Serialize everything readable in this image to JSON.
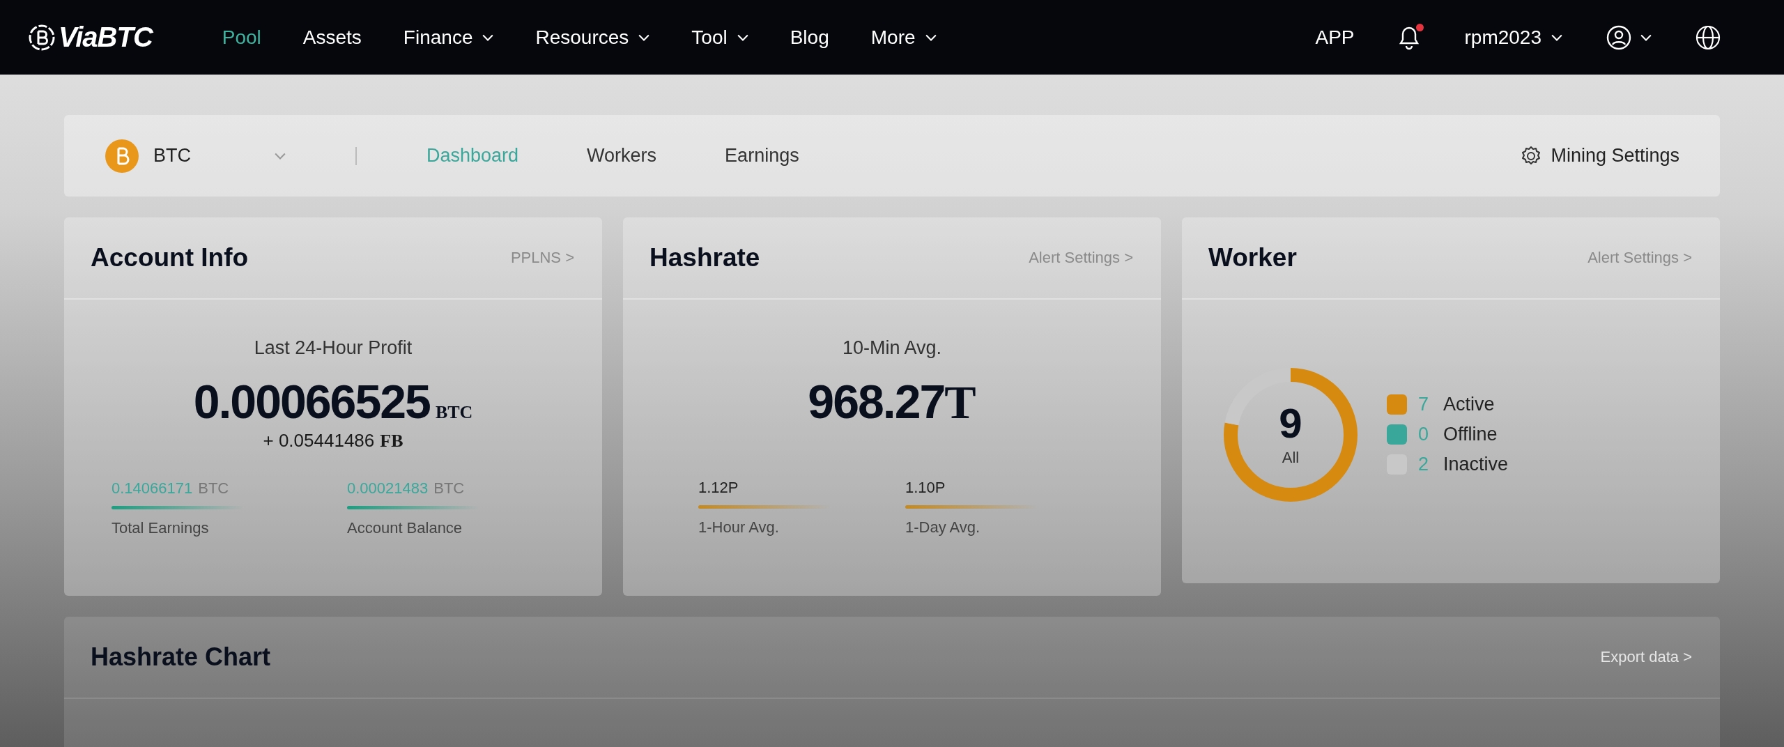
{
  "nav": {
    "logo": "ViaBTC",
    "items": [
      {
        "label": "Pool",
        "selected": true,
        "dropdown": false
      },
      {
        "label": "Assets",
        "selected": false,
        "dropdown": false
      },
      {
        "label": "Finance",
        "selected": false,
        "dropdown": true
      },
      {
        "label": "Resources",
        "selected": false,
        "dropdown": true
      },
      {
        "label": "Tool",
        "selected": false,
        "dropdown": true
      },
      {
        "label": "Blog",
        "selected": false,
        "dropdown": false
      },
      {
        "label": "More",
        "selected": false,
        "dropdown": true
      }
    ],
    "app": "APP",
    "notification_dot": true,
    "username": "rpm2023"
  },
  "subnav": {
    "coin": "BTC",
    "tabs": [
      {
        "label": "Dashboard",
        "selected": true
      },
      {
        "label": "Workers",
        "selected": false
      },
      {
        "label": "Earnings",
        "selected": false
      }
    ],
    "settings": "Mining Settings"
  },
  "account_info": {
    "title": "Account Info",
    "link": "PPLNS >",
    "caption": "Last 24-Hour Profit",
    "value": "0.00066525",
    "unit": "BTC",
    "extra_value": "+ 0.05441486",
    "extra_unit": "FB",
    "stats": [
      {
        "value": "0.14066171",
        "unit": "BTC",
        "label": "Total Earnings"
      },
      {
        "value": "0.00021483",
        "unit": "BTC",
        "label": "Account Balance"
      }
    ]
  },
  "hashrate": {
    "title": "Hashrate",
    "link": "Alert Settings >",
    "caption": "10-Min Avg.",
    "value": "968.27",
    "unit": "T",
    "stats": [
      {
        "value": "1.12P",
        "label": "1-Hour Avg."
      },
      {
        "value": "1.10P",
        "label": "1-Day Avg."
      }
    ]
  },
  "worker": {
    "title": "Worker",
    "link": "Alert Settings >",
    "total": "9",
    "total_label": "All",
    "legend": [
      {
        "count": "7",
        "label": "Active",
        "color": "#d68a10"
      },
      {
        "count": "0",
        "label": "Offline",
        "color": "#3aa79b"
      },
      {
        "count": "2",
        "label": "Inactive",
        "color": "#c8c8c8"
      }
    ]
  },
  "hashrate_chart": {
    "title": "Hashrate Chart",
    "link": "Export data >"
  }
}
